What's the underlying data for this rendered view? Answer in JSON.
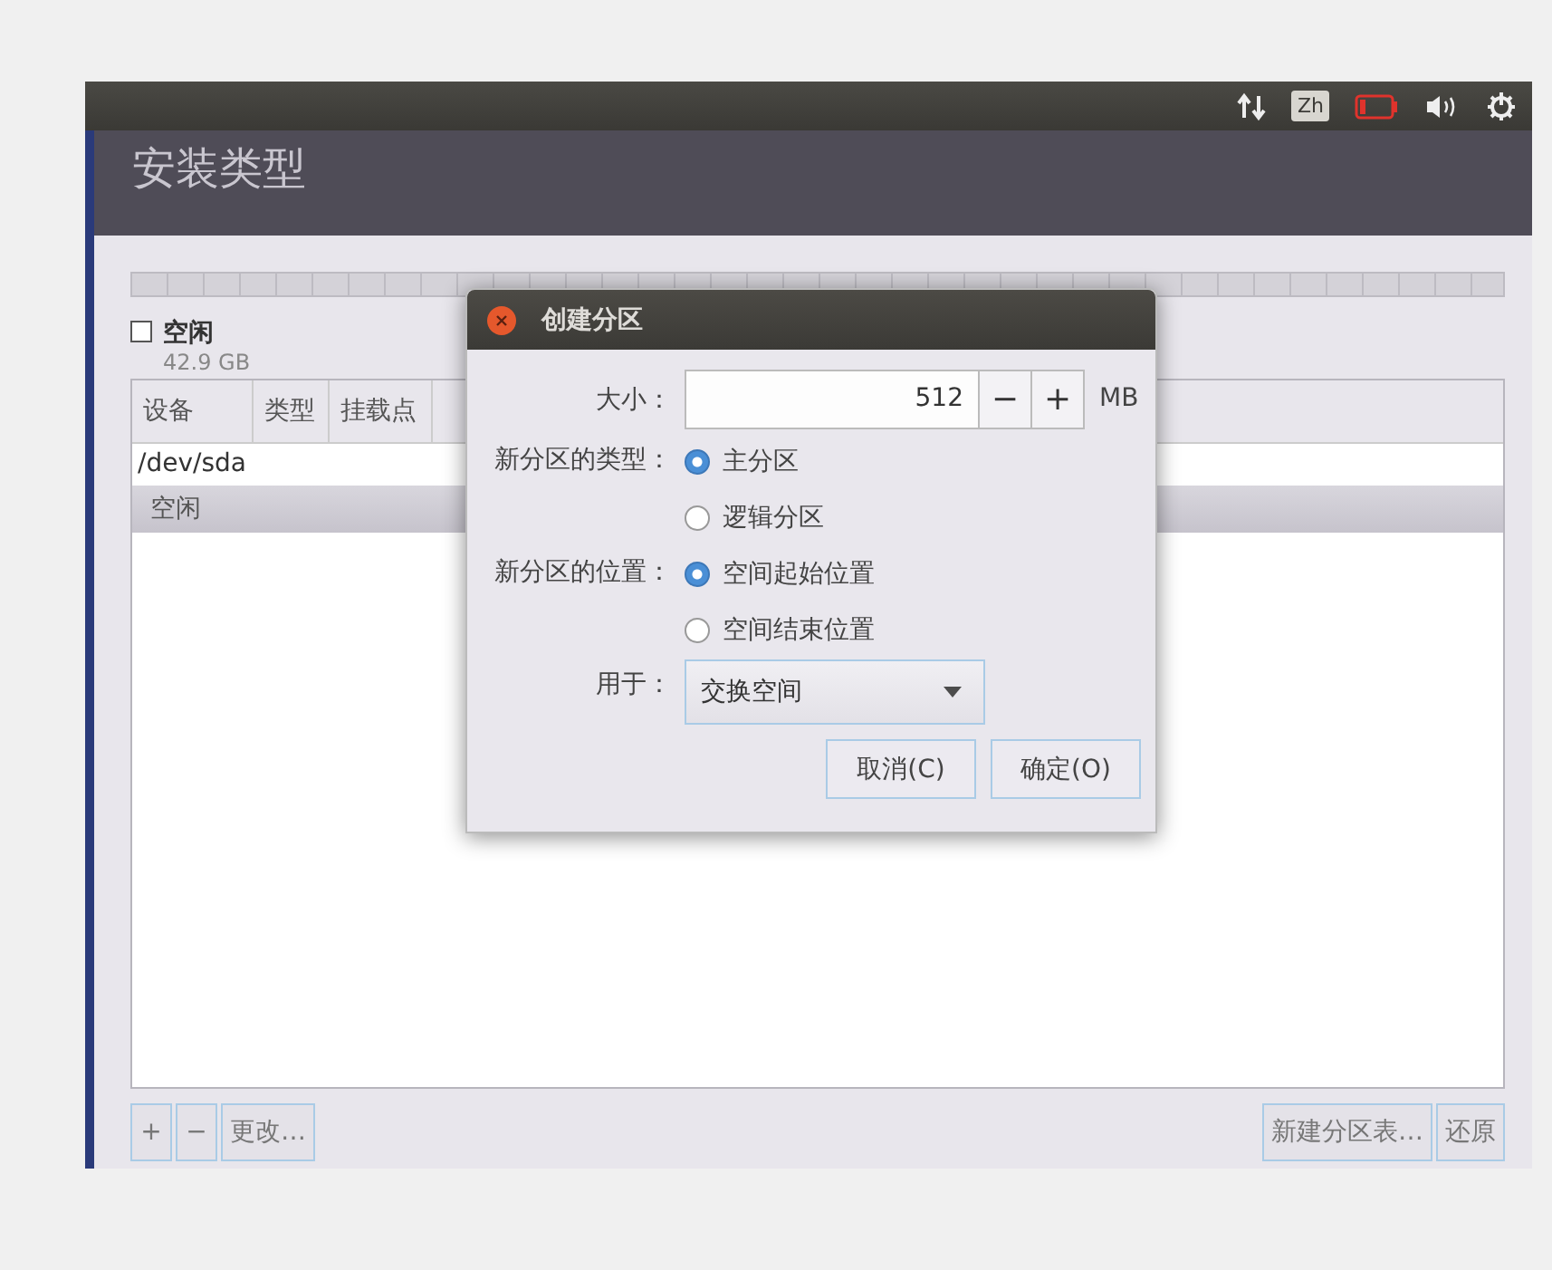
{
  "top_panel": {
    "keyboard_indicator": "Zh"
  },
  "window": {
    "title": "安装类型"
  },
  "disks": [
    {
      "label": "空闲",
      "size": "42.9 GB",
      "checked": false
    }
  ],
  "table": {
    "columns": [
      "设备",
      "类型",
      "挂载点"
    ],
    "rows": [
      {
        "kind": "device",
        "device": "/dev/sda",
        "selected": false
      },
      {
        "kind": "partition",
        "device": "空闲",
        "selected": true
      }
    ]
  },
  "toolbar": {
    "left": [
      "+",
      "−",
      "更改…"
    ],
    "right": [
      "新建分区表…",
      "还原"
    ]
  },
  "dialog": {
    "title": "创建分区",
    "size": {
      "label": "大小：",
      "value": "512",
      "minus": "−",
      "plus": "+",
      "unit": "MB"
    },
    "groups": [
      {
        "label": "新分区的类型：",
        "options": [
          {
            "label": "主分区",
            "selected": true
          },
          {
            "label": "逻辑分区",
            "selected": false
          }
        ]
      },
      {
        "label": "新分区的位置：",
        "options": [
          {
            "label": "空间起始位置",
            "selected": true
          },
          {
            "label": "空间结束位置",
            "selected": false
          }
        ]
      }
    ],
    "use_for": {
      "label": "用于：",
      "value": "交换空间"
    },
    "buttons": [
      "取消(C)",
      "确定(O)"
    ]
  }
}
